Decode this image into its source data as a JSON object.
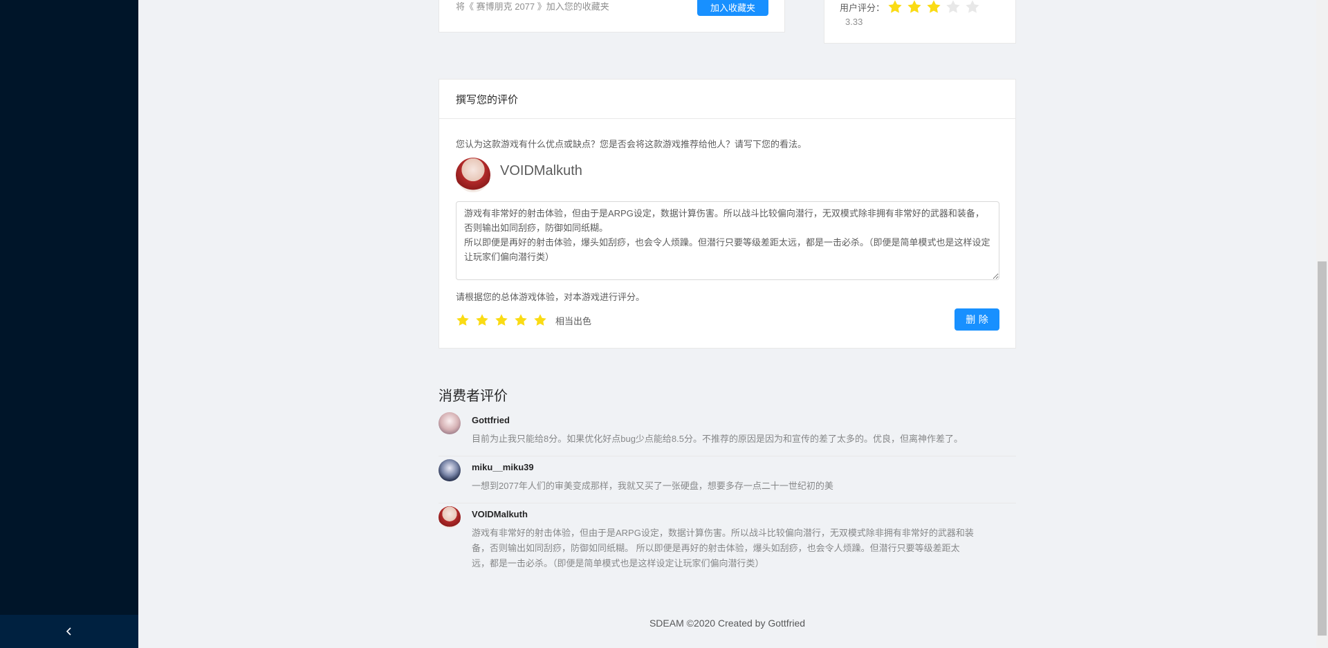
{
  "favorites": {
    "text": "将《 赛博朋克 2077 》加入您的收藏夹",
    "button": "加入收藏夹"
  },
  "rating": {
    "label": "用户评分：",
    "stars": 3,
    "max": 5,
    "value": "3.33"
  },
  "review": {
    "title": "撰写您的评价",
    "hint": "您认为这款游戏有什么优点或缺点？您是否会将这款游戏推荐给他人？请写下您的看法。",
    "user": "VOIDMalkuth",
    "text": "游戏有非常好的射击体验，但由于是ARPG设定，数据计算伤害。所以战斗比较偏向潜行，无双模式除非拥有非常好的武器和装备，否则输出如同刮痧，防御如同纸糊。\n所以即便是再好的射击体验，爆头如刮痧，也会令人烦躁。但潜行只要等级差距太远，都是一击必杀。（即便是简单模式也是这样设定让玩家们偏向潜行类）",
    "rate_hint": "请根据您的总体游戏体验，对本游戏进行评分。",
    "stars": 5,
    "rate_text": "相当出色",
    "delete_button": "删 除"
  },
  "consumers": {
    "title": "消费者评价",
    "comments": [
      {
        "author": "Gottfried",
        "content": "目前为止我只能给8分。如果优化好点bug少点能给8.5分。不推荐的原因是因为和宣传的差了太多的。优良，但离神作差了。"
      },
      {
        "author": "miku__miku39",
        "content": "一想到2077年人们的审美变成那样，我就又买了一张硬盘，想要多存一点二十一世纪初的美"
      },
      {
        "author": "VOIDMalkuth",
        "content": "游戏有非常好的射击体验，但由于是ARPG设定，数据计算伤害。所以战斗比较偏向潜行，无双模式除非拥有非常好的武器和装备，否则输出如同刮痧，防御如同纸糊。 所以即便是再好的射击体验，爆头如刮痧，也会令人烦躁。但潜行只要等级差距太远，都是一击必杀。（即便是简单模式也是这样设定让玩家们偏向潜行类）"
      }
    ]
  },
  "footer": "SDEAM ©2020 Created by Gottfried",
  "colors": {
    "sidebar": "#001529",
    "sidebar_trigger": "#002140",
    "primary": "#1890ff",
    "star": "#fadb14",
    "background": "#f0f2f5"
  }
}
